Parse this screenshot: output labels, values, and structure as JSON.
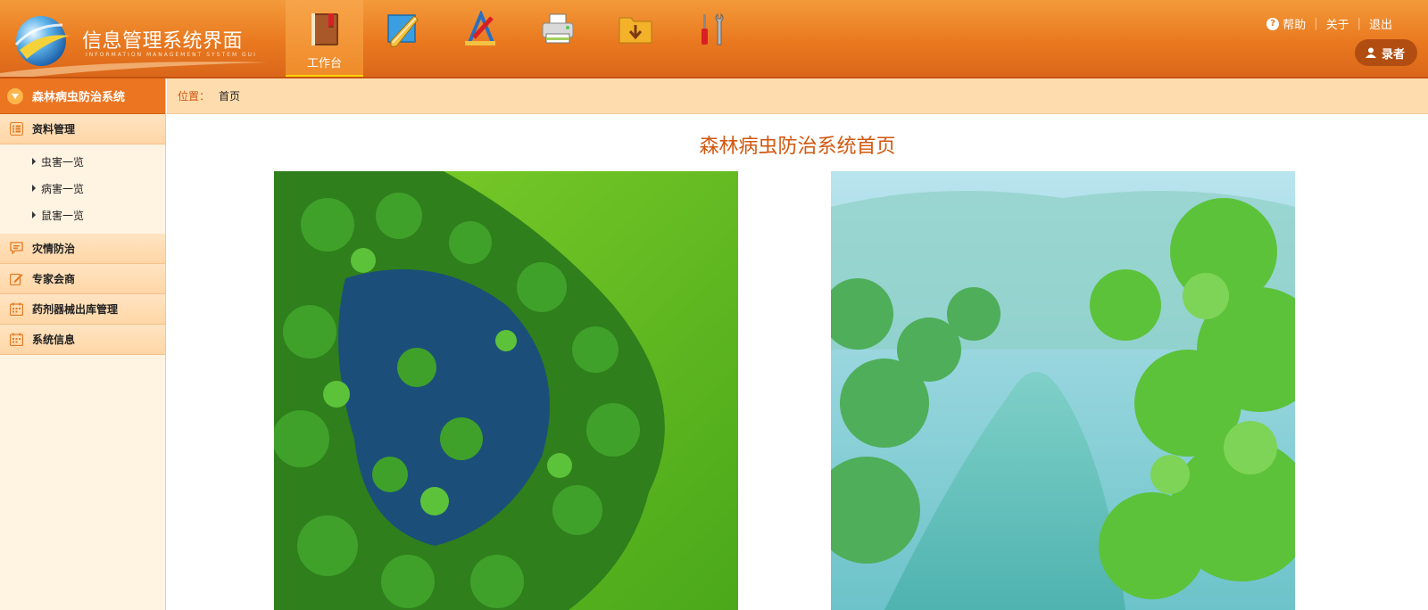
{
  "header": {
    "title": "信息管理系统界面",
    "subtitle": "INFORMATION MANAGEMENT SYSTEM GUI",
    "tools": [
      {
        "name": "book-icon",
        "label": "工作台",
        "active": true
      },
      {
        "name": "ruler-icon",
        "label": "",
        "active": false
      },
      {
        "name": "drawing-tools-icon",
        "label": "",
        "active": false
      },
      {
        "name": "printer-icon",
        "label": "",
        "active": false
      },
      {
        "name": "folder-download-icon",
        "label": "",
        "active": false
      },
      {
        "name": "screwdriver-wrench-icon",
        "label": "",
        "active": false
      }
    ],
    "links": {
      "help": "帮助",
      "about": "关于",
      "logout": "退出"
    },
    "user": "录者"
  },
  "sidebar": {
    "title": "森林病虫防治系统",
    "menus": [
      {
        "label": "资料管理",
        "icon": "list-icon",
        "expanded": true,
        "items": [
          "虫害一览",
          "病害一览",
          "鼠害一览"
        ]
      },
      {
        "label": "灾情防治",
        "icon": "chat-icon"
      },
      {
        "label": "专家会商",
        "icon": "edit-icon"
      },
      {
        "label": "药剂器械出库管理",
        "icon": "calendar-icon"
      },
      {
        "label": "系统信息",
        "icon": "calendar-icon"
      }
    ]
  },
  "breadcrumb": {
    "label": "位置：",
    "current": "首页"
  },
  "main": {
    "title": "森林病虫防治系统首页"
  },
  "colors": {
    "accent": "#e9781f",
    "title": "#d2570f",
    "sidebar_bg": "#fff3e2"
  }
}
